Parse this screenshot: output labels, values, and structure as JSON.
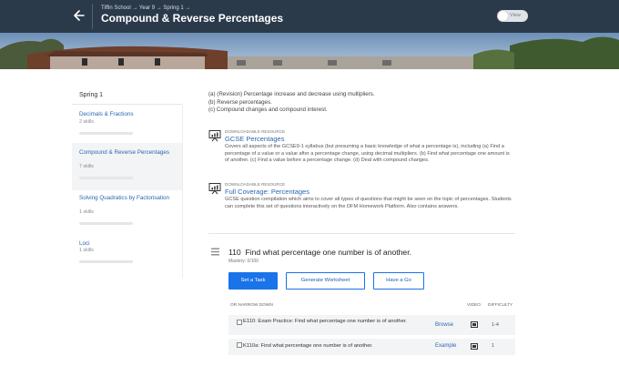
{
  "header": {
    "breadcrumb": "Tiffin School → Year 9 → Spring 1 →",
    "title": "Compound & Reverse Percentages",
    "toggle_label": "View"
  },
  "sidebar": {
    "heading": "Spring 1",
    "items": [
      {
        "name": "Decimals & Fractions",
        "skills": "2 skills",
        "active": false
      },
      {
        "name": "Compound & Reverse Percentages",
        "skills": "7 skills",
        "active": true
      },
      {
        "name": "Solving Quadratics by Factorisation",
        "skills": "1 skills",
        "active": false
      },
      {
        "name": "Loci",
        "skills": "1 skills",
        "active": false
      }
    ]
  },
  "intro": [
    "(a) (Revision) Percentage increase and decrease using multipliers.",
    "(b) Reverse percentages.",
    "(c) Compound changes and compound interest."
  ],
  "resources": [
    {
      "tag": "DOWNLOADABLE RESOURCE",
      "title": "GCSE Percentages",
      "description": "Covers all aspects of the GCSE9-1 syllabus (but presuming a basic knowledge of what a percentage is), including (a) Find a percentage of a value or a value after a percentage change, using decimal multipliers. (b) Find what percentage one amount is of another. (c) Find a value before a percentage change. (d) Deal with compound changes."
    },
    {
      "tag": "DOWNLOADABLE RESOURCE",
      "title": "Full Coverage: Percentages",
      "description": "GCSE question compilation which aims to cover all types of questions that might be seen on the topic of percentages. Students can complete this set of questions interactively on the DFM Homework Platform. Also contains answers."
    }
  ],
  "objective": {
    "number": "110",
    "title": "Find what percentage one number is of another.",
    "mastery": "Mastery: 0/100"
  },
  "buttons": {
    "set_task": "Set a Task",
    "generate_worksheet": "Generate Worksheet",
    "have_a_go": "Have a Go"
  },
  "table": {
    "headers": {
      "narrow": "OR NARROW DOWN",
      "video": "VIDEO",
      "difficulty": "DIFFICULTY"
    },
    "rows": [
      {
        "text": "E110: Exam Practice: Find what percentage one number is of another.",
        "link": "Browse",
        "difficulty": "1-4"
      },
      {
        "text": "K110a: Find what percentage one number is of another.",
        "link": "Example",
        "difficulty": "1"
      }
    ]
  },
  "colors": {
    "header_bg": "#2a3a4a",
    "accent": "#1a73e8",
    "link": "#2a67b1"
  },
  "icons": [
    "back-arrow-icon",
    "presentation-icon",
    "drag-handle-icon",
    "video-icon",
    "checkbox"
  ]
}
